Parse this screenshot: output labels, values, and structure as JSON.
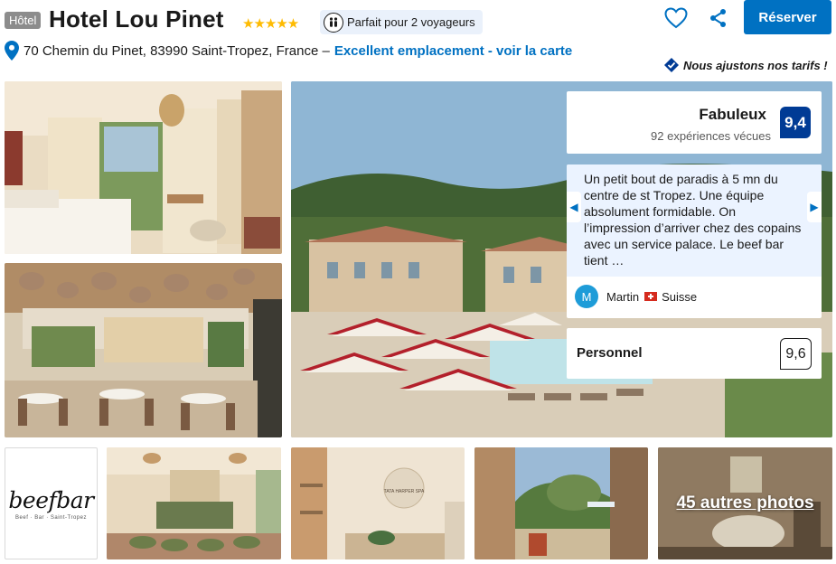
{
  "header": {
    "type_badge": "Hôtel",
    "hotel_name": "Hotel Lou Pinet",
    "stars": "★★★★★",
    "traveller_badge": "Parfait pour 2 voyageurs",
    "address": "70 Chemin du Pinet, 83990 Saint-Tropez, France –",
    "map_link": "Excellent emplacement - voir la carte",
    "reserve_label": "Réserver",
    "price_match": "Nous ajustons nos tarifs !"
  },
  "rating": {
    "label": "Fabuleux",
    "reviews_count": "92 expériences vécues",
    "score": "9,4"
  },
  "review": {
    "text": "Un petit bout de paradis à 5 mn du centre de st Tropez. Une équipe absolument formidable. On l’impression d’arriver chez des copains avec un service palace. Le beef bar tient …",
    "reviewer_initial": "M",
    "reviewer_name": "Martin",
    "reviewer_country": "Suisse"
  },
  "staff": {
    "label": "Personnel",
    "score": "9,6"
  },
  "gallery": {
    "beefbar_logo": "beefbar",
    "beefbar_sub": "Beef · Bar · Saint-Tropez",
    "spa_sign": "TATA HARPER SPA",
    "more_photos": "45 autres photos"
  },
  "colors": {
    "brand_blue": "#0071c2",
    "score_navy": "#003b95",
    "star_yellow": "#febb02",
    "review_bg": "#ebf3ff"
  }
}
